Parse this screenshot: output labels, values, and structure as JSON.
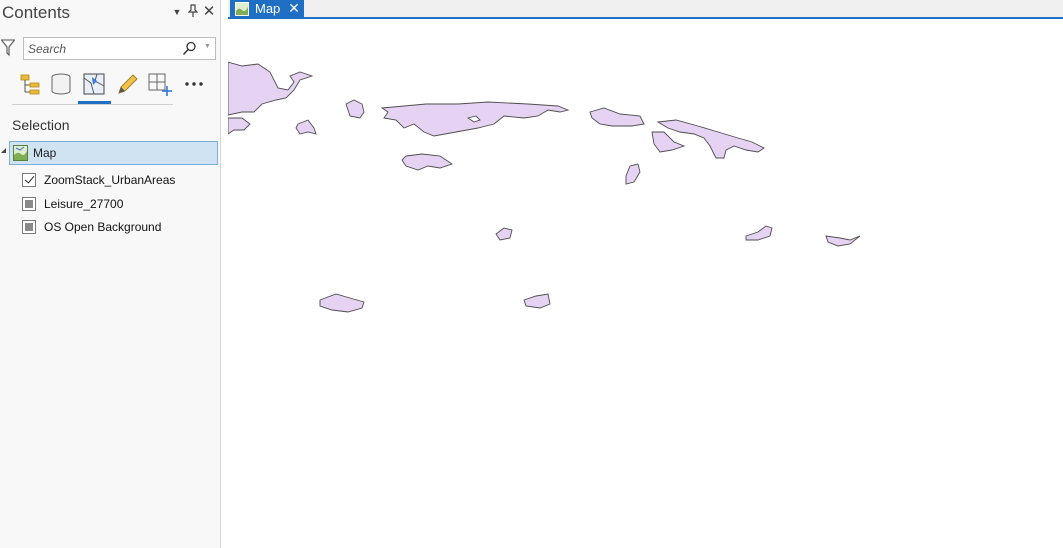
{
  "contents_pane": {
    "title": "Contents",
    "search": {
      "placeholder": "Search"
    },
    "toolbar": {
      "items": [
        "list-by-drawing-order-icon",
        "list-by-source-icon",
        "list-by-selection-icon",
        "list-by-editing-icon",
        "list-by-snapping-icon",
        "more-icon"
      ],
      "active": "list-by-selection-icon"
    },
    "section_label": "Selection",
    "map_node": {
      "label": "Map"
    },
    "layers": [
      {
        "label": "ZoomStack_UrbanAreas",
        "state": "checked"
      },
      {
        "label": "Leisure_27700",
        "state": "indeterminate"
      },
      {
        "label": "OS Open Background",
        "state": "indeterminate"
      }
    ]
  },
  "map_view": {
    "tab": {
      "label": "Map",
      "close_glyph": "✕"
    }
  },
  "colors": {
    "accent": "#1f6fc5",
    "selected_row": "#cfe3f3",
    "polygon_fill": "#e6d2f2",
    "polygon_stroke": "#4e4e4e"
  }
}
